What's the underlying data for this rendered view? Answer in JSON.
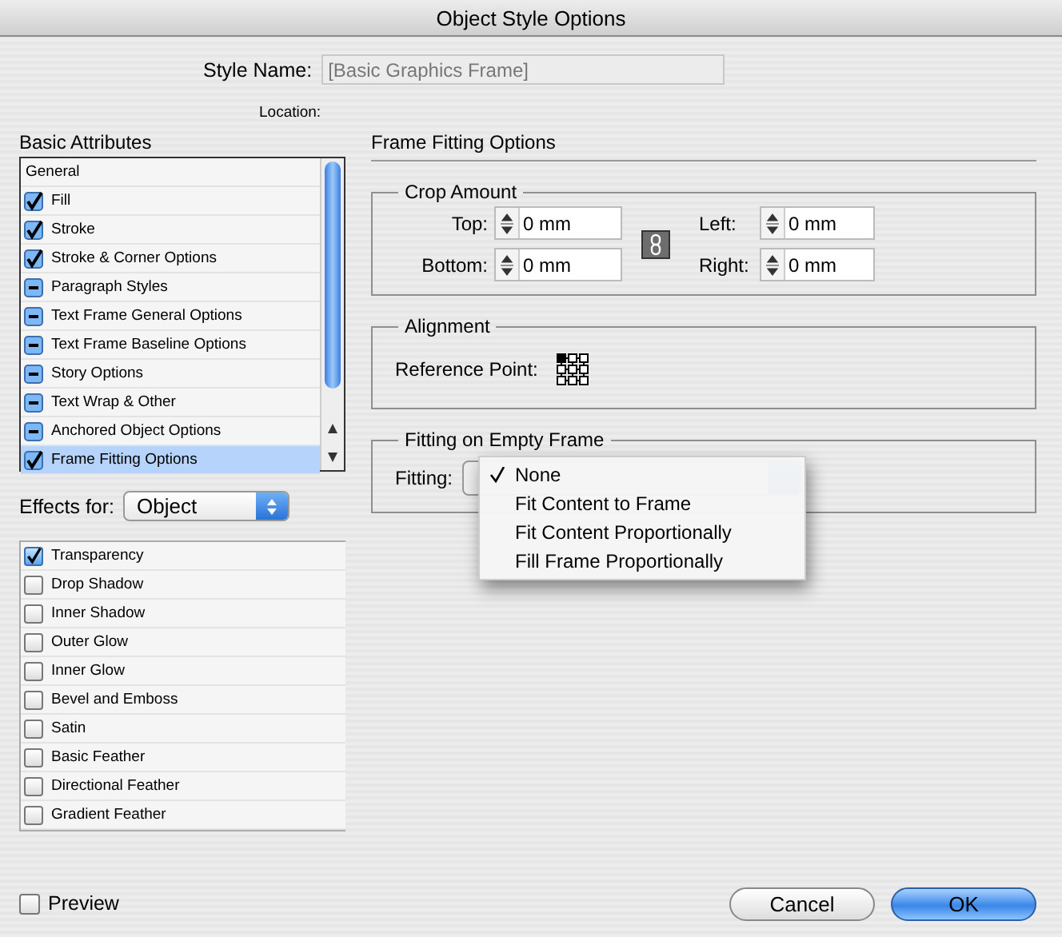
{
  "window": {
    "title": "Object Style Options"
  },
  "style_name": {
    "label": "Style Name:",
    "value": "[Basic Graphics Frame]",
    "disabled": true
  },
  "location": {
    "label": "Location:"
  },
  "basic_attributes": {
    "title": "Basic Attributes",
    "items": [
      {
        "label": "General",
        "kind": "heading",
        "selected": false
      },
      {
        "label": "Fill",
        "kind": "checkbox",
        "checked": true,
        "mixed": false,
        "selected": false
      },
      {
        "label": "Stroke",
        "kind": "checkbox",
        "checked": true,
        "mixed": false,
        "selected": false
      },
      {
        "label": "Stroke & Corner Options",
        "kind": "checkbox",
        "checked": true,
        "mixed": false,
        "selected": false
      },
      {
        "label": "Paragraph Styles",
        "kind": "checkbox",
        "checked": false,
        "mixed": true,
        "selected": false
      },
      {
        "label": "Text Frame General Options",
        "kind": "checkbox",
        "checked": false,
        "mixed": true,
        "selected": false
      },
      {
        "label": "Text Frame Baseline Options",
        "kind": "checkbox",
        "checked": false,
        "mixed": true,
        "selected": false
      },
      {
        "label": "Story Options",
        "kind": "checkbox",
        "checked": false,
        "mixed": true,
        "selected": false
      },
      {
        "label": "Text Wrap & Other",
        "kind": "checkbox",
        "checked": false,
        "mixed": true,
        "selected": false
      },
      {
        "label": "Anchored Object Options",
        "kind": "checkbox",
        "checked": false,
        "mixed": true,
        "selected": false
      },
      {
        "label": "Frame Fitting Options",
        "kind": "checkbox",
        "checked": true,
        "mixed": false,
        "selected": true
      }
    ]
  },
  "effects_for": {
    "label": "Effects for:",
    "value": "Object"
  },
  "effects": [
    {
      "label": "Transparency",
      "checked": true
    },
    {
      "label": "Drop Shadow",
      "checked": false
    },
    {
      "label": "Inner Shadow",
      "checked": false
    },
    {
      "label": "Outer Glow",
      "checked": false
    },
    {
      "label": "Inner Glow",
      "checked": false
    },
    {
      "label": "Bevel and Emboss",
      "checked": false
    },
    {
      "label": "Satin",
      "checked": false
    },
    {
      "label": "Basic Feather",
      "checked": false
    },
    {
      "label": "Directional Feather",
      "checked": false
    },
    {
      "label": "Gradient Feather",
      "checked": false
    }
  ],
  "panel": {
    "title": "Frame Fitting Options",
    "crop_amount": {
      "title": "Crop Amount",
      "fields": [
        {
          "label": "Top:",
          "value": "0 mm"
        },
        {
          "label": "Left:",
          "value": "0 mm"
        },
        {
          "label": "Bottom:",
          "value": "0 mm"
        },
        {
          "label": "Right:",
          "value": "0 mm"
        }
      ]
    },
    "alignment": {
      "title": "Alignment",
      "label": "Reference Point:"
    },
    "fitting_group": {
      "title": "Fitting on Empty Frame",
      "label": "Fitting:",
      "menu": [
        {
          "label": "None",
          "selected": true
        },
        {
          "label": "Fit Content to Frame",
          "selected": false
        },
        {
          "label": "Fit Content Proportionally",
          "selected": false
        },
        {
          "label": "Fill Frame Proportionally",
          "selected": false
        }
      ]
    }
  },
  "preview": {
    "label": "Preview",
    "checked": false
  },
  "buttons": [
    {
      "label": "Cancel",
      "default": false
    },
    {
      "label": "OK",
      "default": true
    }
  ]
}
